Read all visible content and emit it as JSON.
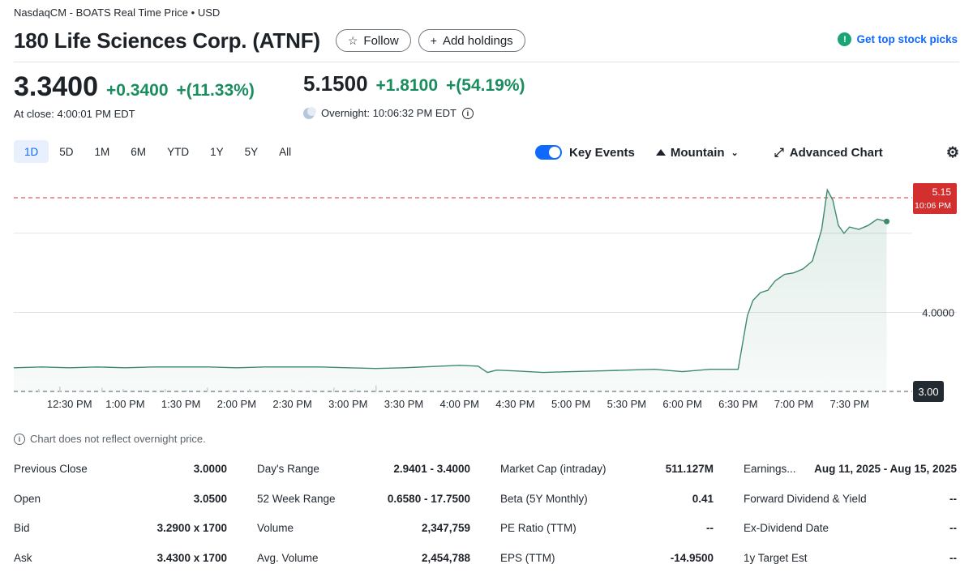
{
  "header": {
    "exchange": "NasdaqCM - BOATS Real Time Price • USD",
    "company": "180 Life Sciences Corp. (ATNF)",
    "follow_label": "Follow",
    "add_holdings_label": "Add holdings",
    "top_picks_label": "Get top stock picks"
  },
  "price": {
    "close_value": "3.3400",
    "close_change": "+0.3400",
    "close_change_pct": "+(11.33%)",
    "close_time": "At close: 4:00:01 PM EDT",
    "overnight_value": "5.1500",
    "overnight_change": "+1.8100",
    "overnight_change_pct": "+(54.19%)",
    "overnight_time": "Overnight: 10:06:32 PM EDT"
  },
  "ranges": [
    "1D",
    "5D",
    "1M",
    "6M",
    "YTD",
    "1Y",
    "5Y",
    "All"
  ],
  "active_range": "1D",
  "toolbar": {
    "key_events_label": "Key Events",
    "key_events_on": true,
    "chart_type_label": "Mountain",
    "advanced_label": "Advanced Chart",
    "settings_icon": "gear-icon"
  },
  "chart_data": {
    "type": "area",
    "x_ticks": [
      "12:30 PM",
      "1:00 PM",
      "1:30 PM",
      "2:00 PM",
      "2:30 PM",
      "3:00 PM",
      "3:30 PM",
      "4:00 PM",
      "4:30 PM",
      "5:00 PM",
      "5:30 PM",
      "6:00 PM",
      "6:30 PM",
      "7:00 PM",
      "7:30 PM"
    ],
    "y_ticks": [
      "4.0000"
    ],
    "ylim": [
      2.99,
      5.85
    ],
    "previous_close_label": "3.00",
    "previous_close_value": 3.0,
    "last_price_label": "5.15",
    "last_time_label": "10:06 PM",
    "last_price_value": 5.15,
    "after_hours_start": "4:00 PM",
    "x": [
      "12:00",
      "12:15",
      "12:30",
      "12:45",
      "1:00",
      "1:15",
      "1:30",
      "1:45",
      "2:00",
      "2:15",
      "2:30",
      "2:45",
      "3:00",
      "3:15",
      "3:30",
      "3:40",
      "3:50",
      "4:00",
      "4:10",
      "4:15",
      "4:20",
      "4:30",
      "4:45",
      "5:00",
      "5:15",
      "5:30",
      "5:45",
      "6:00",
      "6:15",
      "6:30",
      "6:35",
      "6:38",
      "6:42",
      "6:46",
      "6:50",
      "6:55",
      "7:00",
      "7:05",
      "7:10",
      "7:15",
      "7:18",
      "7:21",
      "7:24",
      "7:27",
      "7:30",
      "7:35",
      "7:40",
      "7:45",
      "7:50"
    ],
    "values": [
      3.3,
      3.31,
      3.3,
      3.31,
      3.3,
      3.31,
      3.31,
      3.31,
      3.3,
      3.31,
      3.31,
      3.31,
      3.3,
      3.29,
      3.3,
      3.31,
      3.32,
      3.33,
      3.32,
      3.24,
      3.27,
      3.26,
      3.24,
      3.25,
      3.26,
      3.27,
      3.28,
      3.25,
      3.28,
      3.28,
      3.96,
      4.15,
      4.25,
      4.28,
      4.4,
      4.48,
      4.5,
      4.55,
      4.65,
      5.05,
      5.55,
      5.42,
      5.1,
      5.0,
      5.08,
      5.05,
      5.1,
      5.18,
      5.15
    ],
    "volume_bars": [
      0.3,
      0.5,
      0.2,
      0.4,
      0.3,
      0.2,
      0.3,
      0.2,
      0.4,
      0.2,
      0.3,
      0.2,
      0.3,
      0.2,
      0.4,
      0.3,
      0.6,
      0.2
    ]
  },
  "chart_note": "Chart does not reflect overnight price.",
  "stats": [
    [
      {
        "label": "Previous Close",
        "value": "3.0000"
      },
      {
        "label": "Open",
        "value": "3.0500"
      },
      {
        "label": "Bid",
        "value": "3.2900 x 1700"
      },
      {
        "label": "Ask",
        "value": "3.4300 x 1700"
      }
    ],
    [
      {
        "label": "Day's Range",
        "value": "2.9401 - 3.4000"
      },
      {
        "label": "52 Week Range",
        "value": "0.6580 - 17.7500"
      },
      {
        "label": "Volume",
        "value": "2,347,759"
      },
      {
        "label": "Avg. Volume",
        "value": "2,454,788"
      }
    ],
    [
      {
        "label": "Market Cap (intraday)",
        "value": "511.127M"
      },
      {
        "label": "Beta (5Y Monthly)",
        "value": "0.41"
      },
      {
        "label": "PE Ratio (TTM)",
        "value": "--"
      },
      {
        "label": "EPS (TTM)",
        "value": "-14.9500"
      }
    ],
    [
      {
        "label": "Earnings...",
        "value": "Aug 11, 2025 - Aug 15, 2025"
      },
      {
        "label": "Forward Dividend & Yield",
        "value": "--"
      },
      {
        "label": "Ex-Dividend Date",
        "value": "--"
      },
      {
        "label": "1y Target Est",
        "value": "--"
      }
    ]
  ],
  "colors": {
    "up": "#1a8d5f",
    "line": "#3f8a6a",
    "accent": "#0f69ff",
    "last_price_badge": "#d32f2f",
    "prev_close_badge": "#232a31"
  }
}
